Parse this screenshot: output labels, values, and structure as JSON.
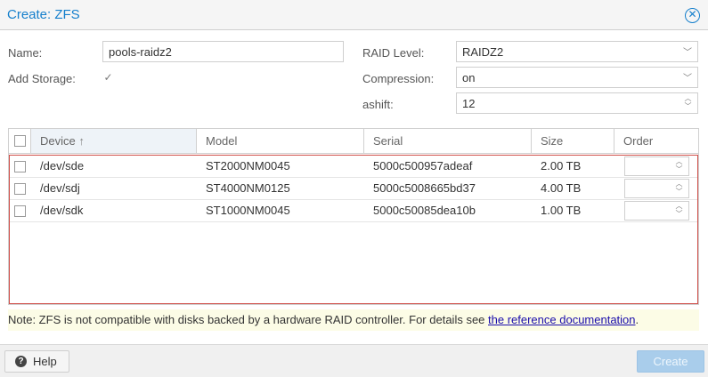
{
  "window": {
    "title": "Create: ZFS",
    "close_icon": "close-circle-icon"
  },
  "form": {
    "name_label": "Name:",
    "name_value": "pools-raidz2",
    "add_storage_label": "Add Storage:",
    "add_storage_checked": true,
    "raid_label": "RAID Level:",
    "raid_value": "RAIDZ2",
    "compression_label": "Compression:",
    "compression_value": "on",
    "ashift_label": "ashift:",
    "ashift_value": "12"
  },
  "grid": {
    "columns": [
      "Device",
      "Model",
      "Serial",
      "Size",
      "Order"
    ],
    "sort_indicator": "↑",
    "rows": [
      {
        "device": "/dev/sde",
        "model": "ST2000NM0045",
        "serial": "5000c500957adeaf",
        "size": "2.00 TB"
      },
      {
        "device": "/dev/sdj",
        "model": "ST4000NM0125",
        "serial": "5000c5008665bd37",
        "size": "4.00 TB"
      },
      {
        "device": "/dev/sdk",
        "model": "ST1000NM0045",
        "serial": "5000c50085dea10b",
        "size": "1.00 TB"
      }
    ]
  },
  "note": {
    "text": "Note: ZFS is not compatible with disks backed by a hardware RAID controller. For details see ",
    "link": "the reference documentation",
    "suffix": "."
  },
  "footer": {
    "help_label": "Help",
    "create_label": "Create"
  }
}
